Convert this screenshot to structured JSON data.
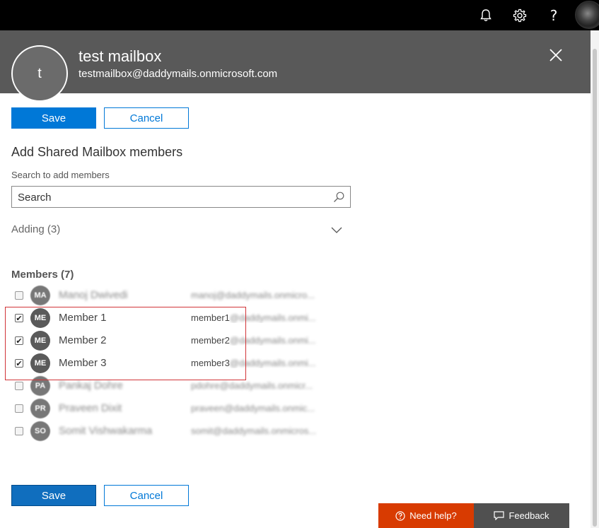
{
  "topbar": {
    "icons": [
      "bell-icon",
      "gear-icon",
      "help-icon",
      "profile-avatar"
    ],
    "help_glyph": "?"
  },
  "header": {
    "avatar_letter": "t",
    "name": "test mailbox",
    "email": "testmailbox@daddymails.onmicrosoft.com"
  },
  "actions": {
    "save_label": "Save",
    "cancel_label": "Cancel"
  },
  "main": {
    "section_title": "Add Shared Mailbox members",
    "search_label": "Search to add members",
    "search_placeholder": "Search",
    "adding_label": "Adding (3)",
    "members_title": "Members (7)"
  },
  "members": [
    {
      "initials": "MA",
      "name": "Manoj Dwivedi",
      "email": "manoj@daddymails.onmicro...",
      "checked": false,
      "blurred": true
    },
    {
      "initials": "ME",
      "name": "Member 1",
      "email_visible": "member1",
      "email_blurred": "@daddymails.onmi...",
      "checked": true,
      "blurred": false
    },
    {
      "initials": "ME",
      "name": "Member 2",
      "email_visible": "member2",
      "email_blurred": "@daddymails.onmi...",
      "checked": true,
      "blurred": false
    },
    {
      "initials": "ME",
      "name": "Member 3",
      "email_visible": "member3",
      "email_blurred": "@daddymails.onmi...",
      "checked": true,
      "blurred": false
    },
    {
      "initials": "PA",
      "name": "Pankaj Dohre",
      "email": "pdohre@daddymails.onmicr...",
      "checked": false,
      "blurred": true
    },
    {
      "initials": "PR",
      "name": "Praveen Dixit",
      "email": "praveen@daddymails.onmic...",
      "checked": false,
      "blurred": true
    },
    {
      "initials": "SO",
      "name": "Somit Vishwakarma",
      "email": "somit@daddymails.onmicros...",
      "checked": false,
      "blurred": true
    }
  ],
  "footer": {
    "need_help_label": "Need help?",
    "feedback_label": "Feedback"
  },
  "colors": {
    "primary": "#0078d7",
    "header_bg": "#595959",
    "highlight": "#d13438",
    "need_help_bg": "#d83b01",
    "feedback_bg": "#505050"
  }
}
